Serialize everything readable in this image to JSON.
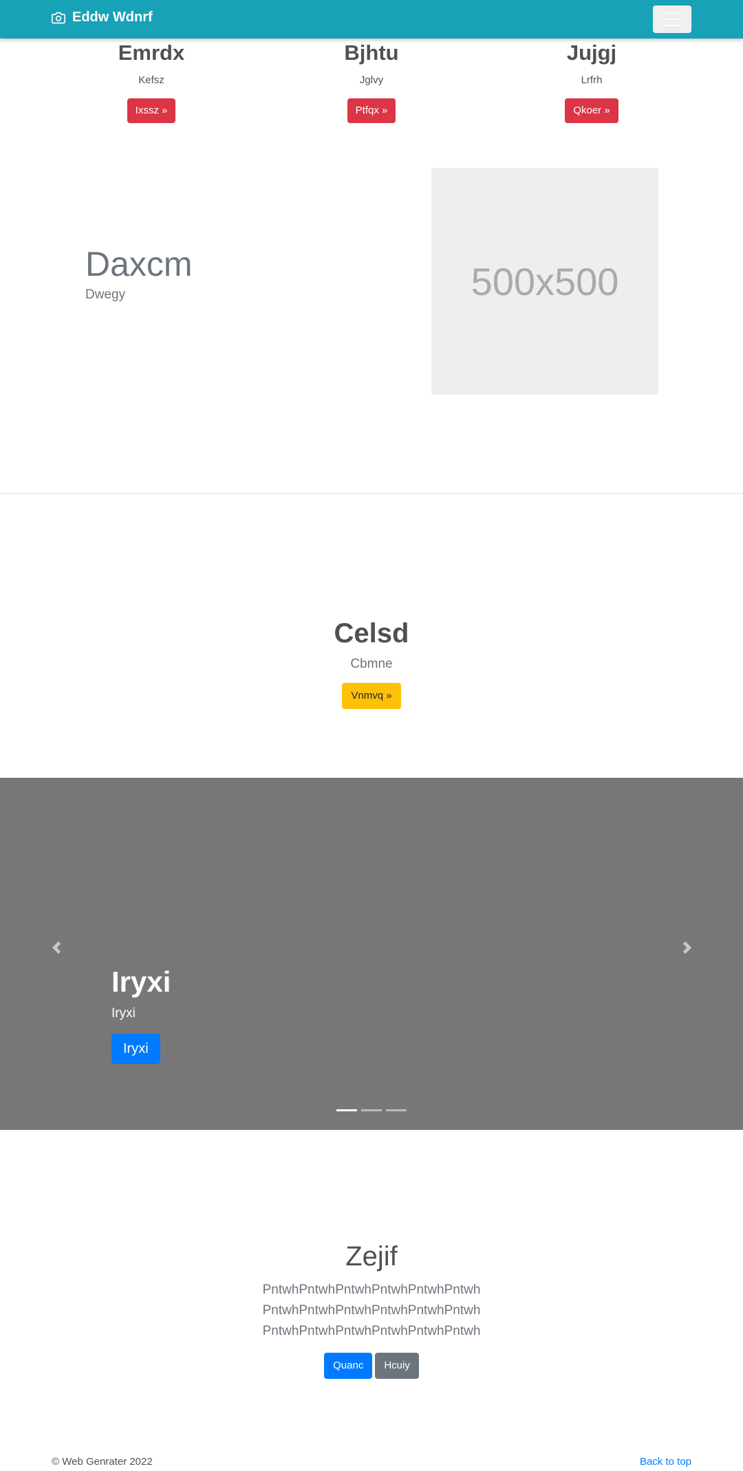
{
  "navbar": {
    "brand": "Eddw Wdnrf",
    "brand_icon": "camera-icon",
    "toggle_icon": "hamburger-icon",
    "background": "#17a2b8"
  },
  "features": [
    {
      "title": "Emrdx",
      "text": "Kefsz",
      "button": "Ixssz »"
    },
    {
      "title": "Bjhtu",
      "text": "Jglvy",
      "button": "Ptfqx »"
    },
    {
      "title": "Jujgj",
      "text": "Lrfrh",
      "button": "Qkoer »"
    }
  ],
  "featurette": {
    "heading": "Daxcm",
    "subheading": "Dwegy",
    "image_label": "500x500"
  },
  "cta": {
    "title": "Celsd",
    "text": "Cbmne",
    "button": "Vnmvq »"
  },
  "carousel": {
    "title": "Iryxi",
    "text": "Iryxi",
    "button": "Iryxi",
    "prev_icon": "chevron-left-icon",
    "next_icon": "chevron-right-icon",
    "active_slide": 1,
    "slide_count": 3
  },
  "jumbotron": {
    "title": "Zejif",
    "lines": [
      "PntwhPntwhPntwhPntwhPntwhPntwh",
      "PntwhPntwhPntwhPntwhPntwhPntwh",
      "PntwhPntwhPntwhPntwhPntwhPntwh"
    ],
    "primary_button": "Quanc",
    "secondary_button": "Hcuiy"
  },
  "footer": {
    "copyright": "© Web Genrater 2022",
    "back_to_top": "Back to top"
  }
}
